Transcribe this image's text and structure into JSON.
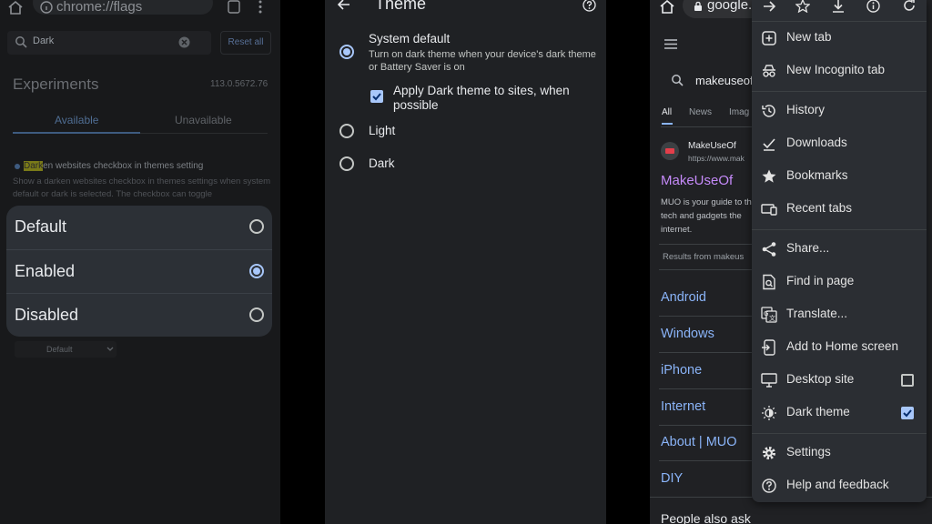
{
  "flags": {
    "url": "chrome://flags",
    "search_value": "Dark",
    "reset_label": "Reset all",
    "title": "Experiments",
    "version": "113.0.5672.76",
    "tabs": [
      "Available",
      "Unavailable"
    ],
    "flag_title_highlight": "Dark",
    "flag_title_rest": "en websites checkbox in themes setting",
    "flag_desc": "Show a darken websites checkbox in themes settings when system default or dark is selected. The checkbox can toggle",
    "options": [
      {
        "label": "Default",
        "selected": false
      },
      {
        "label": "Enabled",
        "selected": true
      },
      {
        "label": "Disabled",
        "selected": false
      }
    ],
    "select_value": "Default"
  },
  "theme": {
    "title": "Theme",
    "system_default_label": "System default",
    "system_default_desc": "Turn on dark theme when your device's dark theme or Battery Saver is on",
    "apply_dark_label": "Apply Dark theme to sites, when possible",
    "light_label": "Light",
    "dark_label": "Dark"
  },
  "search": {
    "omnibox": "google.c",
    "query": "makeuseof",
    "tabs": [
      "All",
      "News",
      "Imag"
    ],
    "site_name": "MakeUseOf",
    "site_url": "https://www.mak",
    "result_title": "MakeUseOf",
    "snippet": "MUO is your guide to the tech and gadgets the internet.",
    "results_from": "Results from makeus",
    "sitelinks": [
      "Android",
      "Windows",
      "iPhone",
      "Internet",
      "About | MUO",
      "DIY"
    ],
    "people_also_ask": "People also ask"
  },
  "menu": {
    "items": [
      {
        "label": "New tab",
        "icon": "new-tab-icon"
      },
      {
        "label": "New Incognito tab",
        "icon": "incognito-icon"
      },
      {
        "label": "History",
        "icon": "history-icon"
      },
      {
        "label": "Downloads",
        "icon": "downloads-icon"
      },
      {
        "label": "Bookmarks",
        "icon": "bookmark-star-icon"
      },
      {
        "label": "Recent tabs",
        "icon": "recent-tabs-icon"
      },
      {
        "label": "Share...",
        "icon": "share-icon"
      },
      {
        "label": "Find in page",
        "icon": "find-in-page-icon"
      },
      {
        "label": "Translate...",
        "icon": "translate-icon"
      },
      {
        "label": "Add to Home screen",
        "icon": "add-to-home-icon"
      },
      {
        "label": "Desktop site",
        "icon": "desktop-icon"
      },
      {
        "label": "Dark theme",
        "icon": "dark-theme-icon"
      },
      {
        "label": "Settings",
        "icon": "settings-gear-icon"
      },
      {
        "label": "Help and feedback",
        "icon": "help-icon"
      }
    ],
    "desktop_site_checked": false,
    "dark_theme_checked": true
  },
  "colors": {
    "accent": "#a8c7fa",
    "link": "#8ab4f8",
    "visited": "#c58af9"
  }
}
